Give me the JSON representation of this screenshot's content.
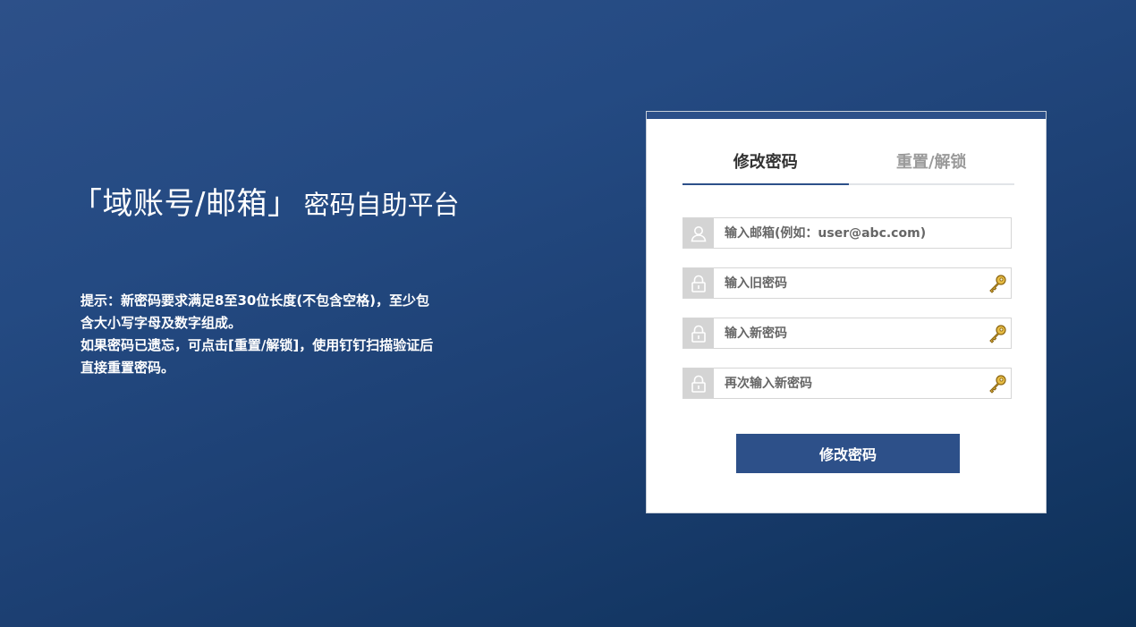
{
  "page": {
    "title_main": "「域账号/邮箱」",
    "title_sub": "密码自助平台"
  },
  "hint": {
    "line1": "提示：新密码要求满足8至30位长度(不包含空格)，至少包含大小写字母及数字组成。",
    "line2": "如果密码已遗忘，可点击[重置/解锁]，使用钉钉扫描验证后直接重置密码。"
  },
  "tabs": [
    {
      "label": "修改密码",
      "active": true
    },
    {
      "label": "重置/解锁",
      "active": false
    }
  ],
  "form": {
    "email": {
      "placeholder": "输入邮箱(例如：user@abc.com)",
      "value": "",
      "icon": "user-icon"
    },
    "old_password": {
      "placeholder": "输入旧密码",
      "value": "",
      "icon": "lock-icon"
    },
    "new_password": {
      "placeholder": "输入新密码",
      "value": "",
      "icon": "lock-icon"
    },
    "confirm_password": {
      "placeholder": "再次输入新密码",
      "value": "",
      "icon": "lock-icon"
    },
    "submit_label": "修改密码"
  },
  "colors": {
    "accent": "#2d5089",
    "background_top": "#2d5089",
    "background_bottom": "#0d3058",
    "icon_box": "#d4d4d4",
    "key_gold": "#d9a72a"
  }
}
